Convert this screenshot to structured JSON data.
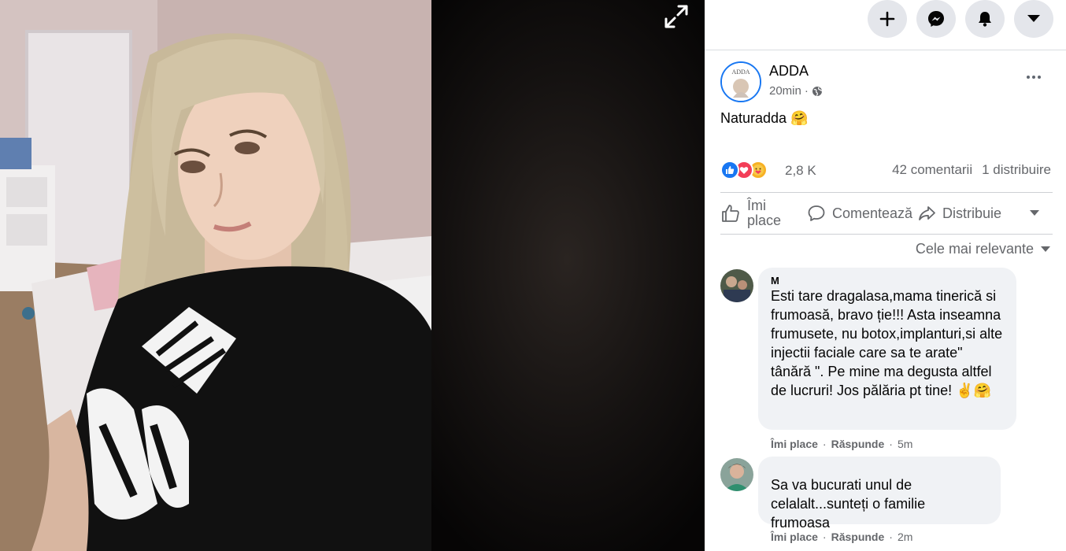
{
  "topbar": {
    "create_icon": "plus-icon",
    "messenger_icon": "messenger-icon",
    "notifications_icon": "bell-icon",
    "account_icon": "caret-down-icon"
  },
  "viewer": {
    "expand_icon": "expand-icon"
  },
  "post": {
    "author": "ADDA",
    "avatar_text": "ADDA",
    "time": "20min",
    "separator": "·",
    "privacy_icon": "globe-icon",
    "caption": "Naturadda 🤗",
    "reactions": {
      "icons": [
        "like-reaction-icon",
        "love-reaction-icon",
        "care-reaction-icon"
      ],
      "count": "2,8 K",
      "comments": "42 comentarii",
      "shares": "1 distribuire"
    },
    "actions": {
      "like_label": "Îmi place",
      "comment_label": "Comentează",
      "share_label": "Distribuie"
    },
    "sort_label": "Cele mai relevante"
  },
  "comments": [
    {
      "name": "M",
      "text": "Esti tare dragalasa,mama tinerică si frumoasă, bravo ție!!! Asta inseamna frumusete, nu botox,implanturi,si alte injectii faciale care sa te arate\" tânără \". Pe mine ma degusta altfel de lucruri! Jos pălăria pt tine! ✌️🤗",
      "like": "Îmi place",
      "reply": "Răspunde",
      "time": "5m"
    },
    {
      "name": "",
      "text": "Sa va bucurati unul de celalalt...sunteți o familie frumoasa",
      "like": "Îmi place",
      "reply": "Răspunde",
      "time": "2m"
    }
  ],
  "colors": {
    "accent": "#1877f2",
    "secondary_text": "#65676b",
    "bubble": "#f0f2f5"
  }
}
